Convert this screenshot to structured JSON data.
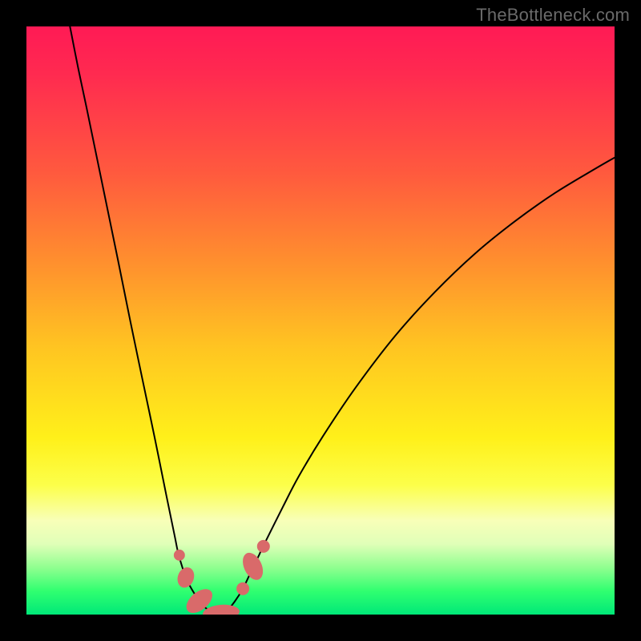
{
  "watermark": {
    "text": "TheBottleneck.com"
  },
  "chart_data": {
    "type": "line",
    "title": "",
    "xlabel": "",
    "ylabel": "",
    "xlim": [
      0,
      100
    ],
    "ylim": [
      0,
      100
    ],
    "grid": false,
    "legend": false,
    "note": "Values are percentages along each axis (0 = bottom / left, 100 = top / right). Curves traced from pixel positions; no axis labels are present in the image so numeric units are relative.",
    "series": [
      {
        "name": "left-curve",
        "x": [
          7.4,
          8.8,
          10.2,
          12.9,
          15.6,
          17.7,
          19.7,
          21.8,
          23.8,
          25.2,
          25.9,
          27.2,
          28.6,
          30.0,
          31.3,
          32.7
        ],
        "y": [
          100.0,
          92.9,
          86.3,
          73.2,
          60.1,
          49.7,
          40.1,
          30.1,
          20.2,
          13.4,
          10.1,
          6.1,
          3.5,
          1.6,
          0.5,
          0.0
        ]
      },
      {
        "name": "right-curve",
        "x": [
          32.7,
          34.1,
          35.4,
          36.8,
          38.1,
          39.5,
          40.2,
          43.6,
          46.3,
          50.4,
          55.9,
          62.7,
          69.5,
          76.3,
          83.1,
          89.9,
          96.7,
          100.0
        ],
        "y": [
          0.0,
          0.7,
          2.2,
          4.4,
          7.1,
          10.0,
          11.5,
          18.3,
          23.5,
          30.3,
          38.5,
          47.4,
          54.9,
          61.4,
          66.9,
          71.7,
          75.8,
          77.7
        ]
      }
    ],
    "markers": [
      {
        "cx": 26.0,
        "cy": 10.1,
        "rx": 0.95,
        "ry": 0.95,
        "rot": 0
      },
      {
        "cx": 27.1,
        "cy": 6.3,
        "rx": 1.36,
        "ry": 1.77,
        "rot": 20
      },
      {
        "cx": 29.4,
        "cy": 2.3,
        "rx": 1.5,
        "ry": 2.59,
        "rot": 50
      },
      {
        "cx": 33.1,
        "cy": 0.3,
        "rx": 1.36,
        "ry": 3.13,
        "rot": 85
      },
      {
        "cx": 36.8,
        "cy": 4.4,
        "rx": 1.09,
        "ry": 1.09,
        "rot": 0
      },
      {
        "cx": 38.5,
        "cy": 8.2,
        "rx": 1.5,
        "ry": 2.45,
        "rot": -25
      },
      {
        "cx": 40.3,
        "cy": 11.6,
        "rx": 1.09,
        "ry": 1.09,
        "rot": 0
      }
    ]
  }
}
